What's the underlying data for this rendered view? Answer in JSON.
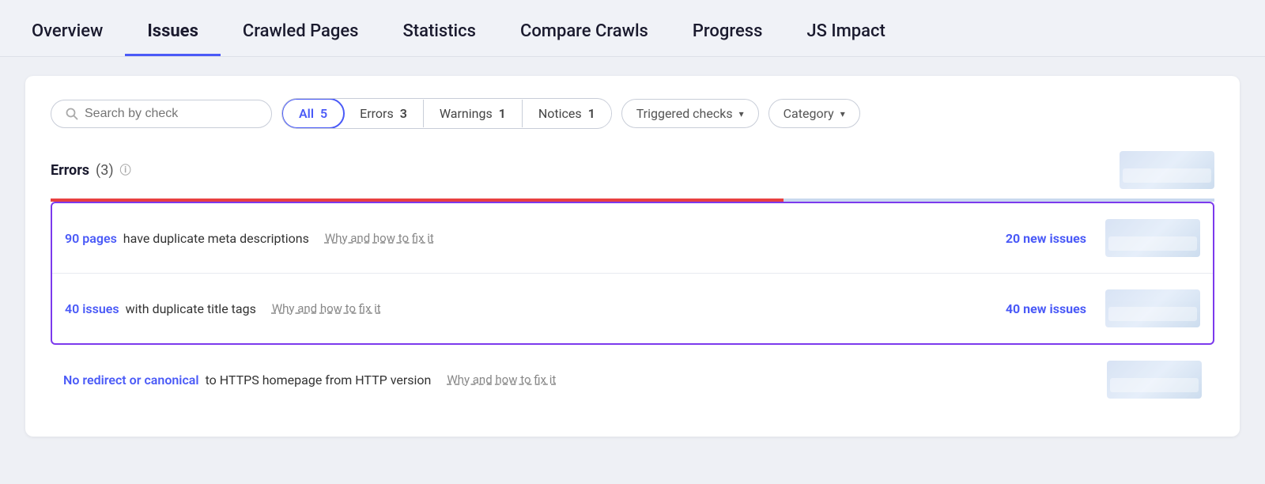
{
  "nav": {
    "items": [
      {
        "id": "overview",
        "label": "Overview",
        "active": false
      },
      {
        "id": "issues",
        "label": "Issues",
        "active": true
      },
      {
        "id": "crawled-pages",
        "label": "Crawled Pages",
        "active": false
      },
      {
        "id": "statistics",
        "label": "Statistics",
        "active": false
      },
      {
        "id": "compare-crawls",
        "label": "Compare Crawls",
        "active": false
      },
      {
        "id": "progress",
        "label": "Progress",
        "active": false
      },
      {
        "id": "js-impact",
        "label": "JS Impact",
        "active": false
      }
    ]
  },
  "filters": {
    "search_placeholder": "Search by check",
    "pills": [
      {
        "id": "all",
        "label": "All",
        "count": "5",
        "active": true
      },
      {
        "id": "errors",
        "label": "Errors",
        "count": "3",
        "active": false
      },
      {
        "id": "warnings",
        "label": "Warnings",
        "count": "1",
        "active": false
      },
      {
        "id": "notices",
        "label": "Notices",
        "count": "1",
        "active": false
      }
    ],
    "triggered_checks": "Triggered checks",
    "category": "Category",
    "chevron": "▾"
  },
  "errors_section": {
    "title": "Errors",
    "count": "(3)",
    "info_icon": "ⓘ"
  },
  "issues": [
    {
      "id": "row-1",
      "link_text": "90 pages",
      "description": " have duplicate meta descriptions",
      "why_fix": "Why and how to fix it",
      "new_issues": "20 new issues",
      "selected": true
    },
    {
      "id": "row-2",
      "link_text": "40 issues",
      "description": " with duplicate title tags",
      "why_fix": "Why and how to fix it",
      "new_issues": "40 new issues",
      "selected": true
    },
    {
      "id": "row-3",
      "link_text": "No redirect or canonical",
      "description": " to HTTPS homepage from HTTP version",
      "why_fix": "Why and how to fix it",
      "new_issues": null,
      "selected": false
    }
  ]
}
